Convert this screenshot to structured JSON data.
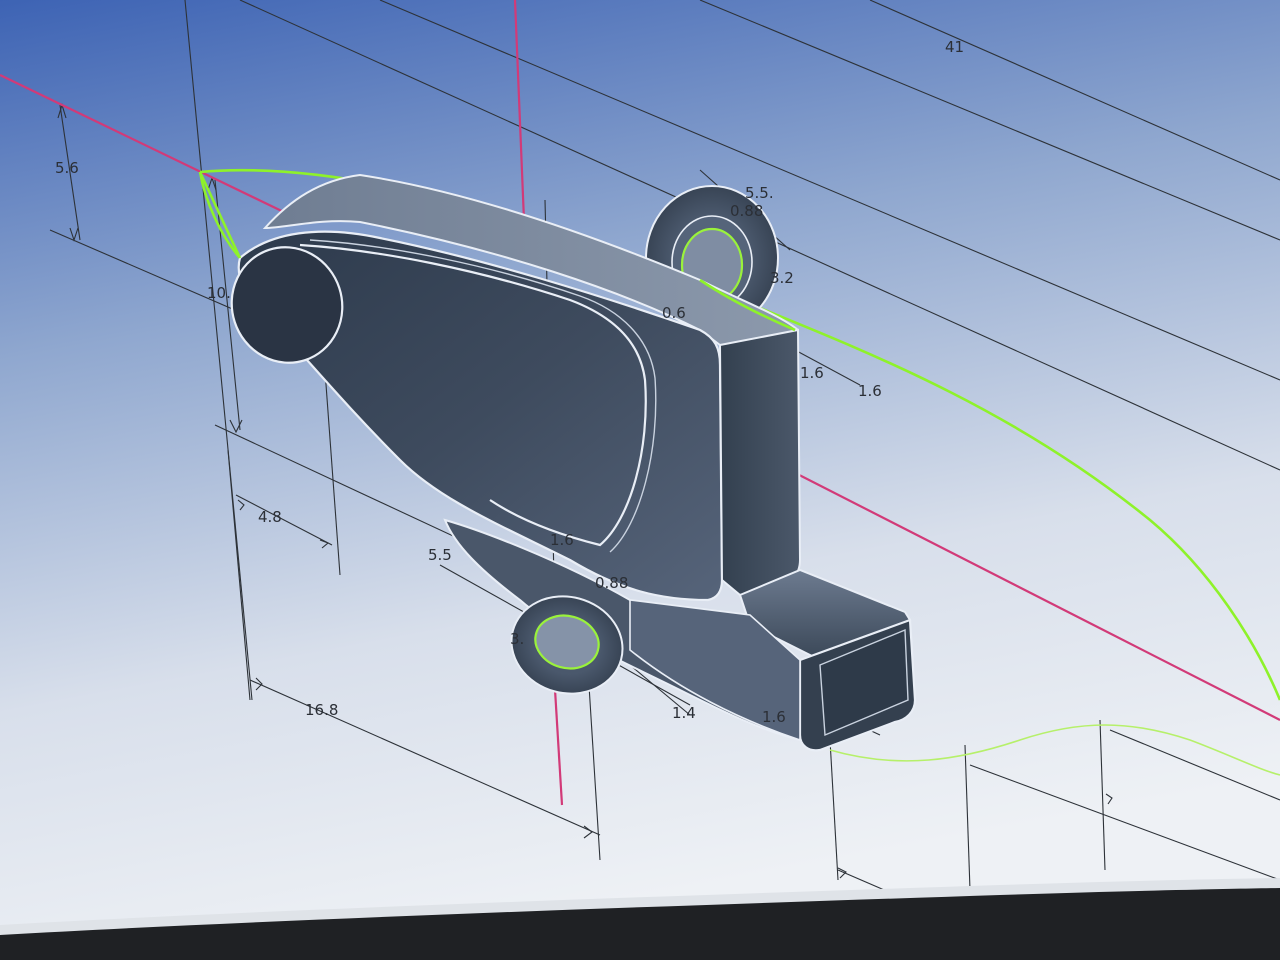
{
  "viewport": {
    "background_top": "#3d63b4",
    "background_bottom": "#e9edf3",
    "model_color": "#3b4757",
    "sketch_curve_color": "#8ef22a",
    "axis_color": "#d23a78",
    "dimension_color": "#2d3238"
  },
  "dimensions": {
    "d_41": "41",
    "d_5_6": "5.6",
    "d_10": "10.",
    "d_4_8": "4.8",
    "d_16_8": "16.8",
    "d_5_5_top": "5.5.",
    "d_0_88_top": "0.88",
    "d_3_2_top": "3.2",
    "d_0_6": "0.6",
    "d_1_6_a": "1.6",
    "d_1_6_b": "1.6",
    "d_5_5_bottom": "5.5",
    "d_1_6_bottom": "1.6",
    "d_0_88_bottom": "0.88",
    "d_3_bottom": "3.",
    "d_1_4": "1.4",
    "d_1_6_c": "1.6"
  }
}
